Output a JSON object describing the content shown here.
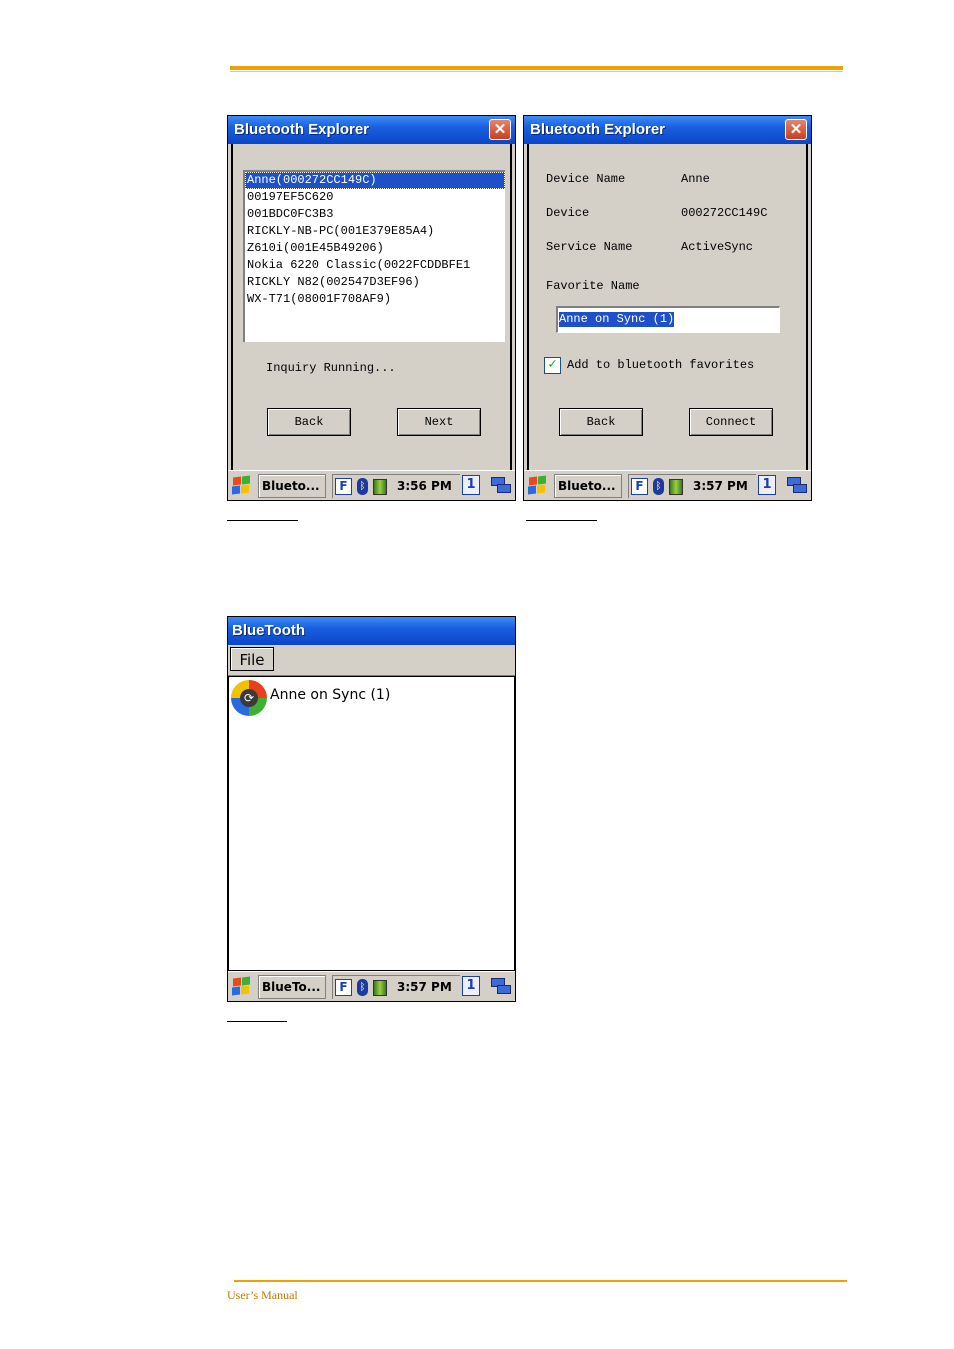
{
  "footer": {
    "text": "User’s Manual"
  },
  "screen1": {
    "title": "Bluetooth Explorer",
    "close_glyph": "✕",
    "devices": [
      "Anne(000272CC149C)",
      "00197EF5C620",
      "001BDC0FC3B3",
      "RICKLY-NB-PC(001E379E85A4)",
      "Z610i(001E45B49206)",
      "Nokia 6220 Classic(0022FCDDBFE1",
      "RICKLY N82(002547D3EF96)",
      "WX-T71(08001F708AF9)"
    ],
    "status": "Inquiry Running...",
    "back_label": "Back",
    "next_label": "Next",
    "taskbar": {
      "task": "Blueto...",
      "time": "3:56 PM",
      "tray_f": "F",
      "desk_num": "1"
    }
  },
  "screen2": {
    "title": "Bluetooth Explorer",
    "close_glyph": "✕",
    "device_name_label": "Device Name",
    "device_name_value": "Anne",
    "device_label": "Device",
    "device_value": "000272CC149C",
    "service_name_label": "Service Name",
    "service_name_value": "ActiveSync",
    "favorite_name_label": "Favorite Name",
    "favorite_name_value": "Anne on Sync (1)",
    "checkbox_label": "Add to bluetooth favorites",
    "checkbox_mark": "✓",
    "back_label": "Back",
    "connect_label": "Connect",
    "taskbar": {
      "task": "Blueto...",
      "time": "3:57 PM",
      "tray_f": "F",
      "desk_num": "1"
    }
  },
  "screen3": {
    "title": "BlueTooth",
    "menu_file": "File",
    "favorite_item": "Anne on Sync (1)",
    "taskbar": {
      "task": "BlueTo...",
      "time": "3:57 PM",
      "tray_f": "F",
      "desk_num": "1"
    }
  },
  "colors": {
    "accent_rule": "#f0a000",
    "title_blue": "#0a46c8",
    "selection": "#1e50c8"
  }
}
